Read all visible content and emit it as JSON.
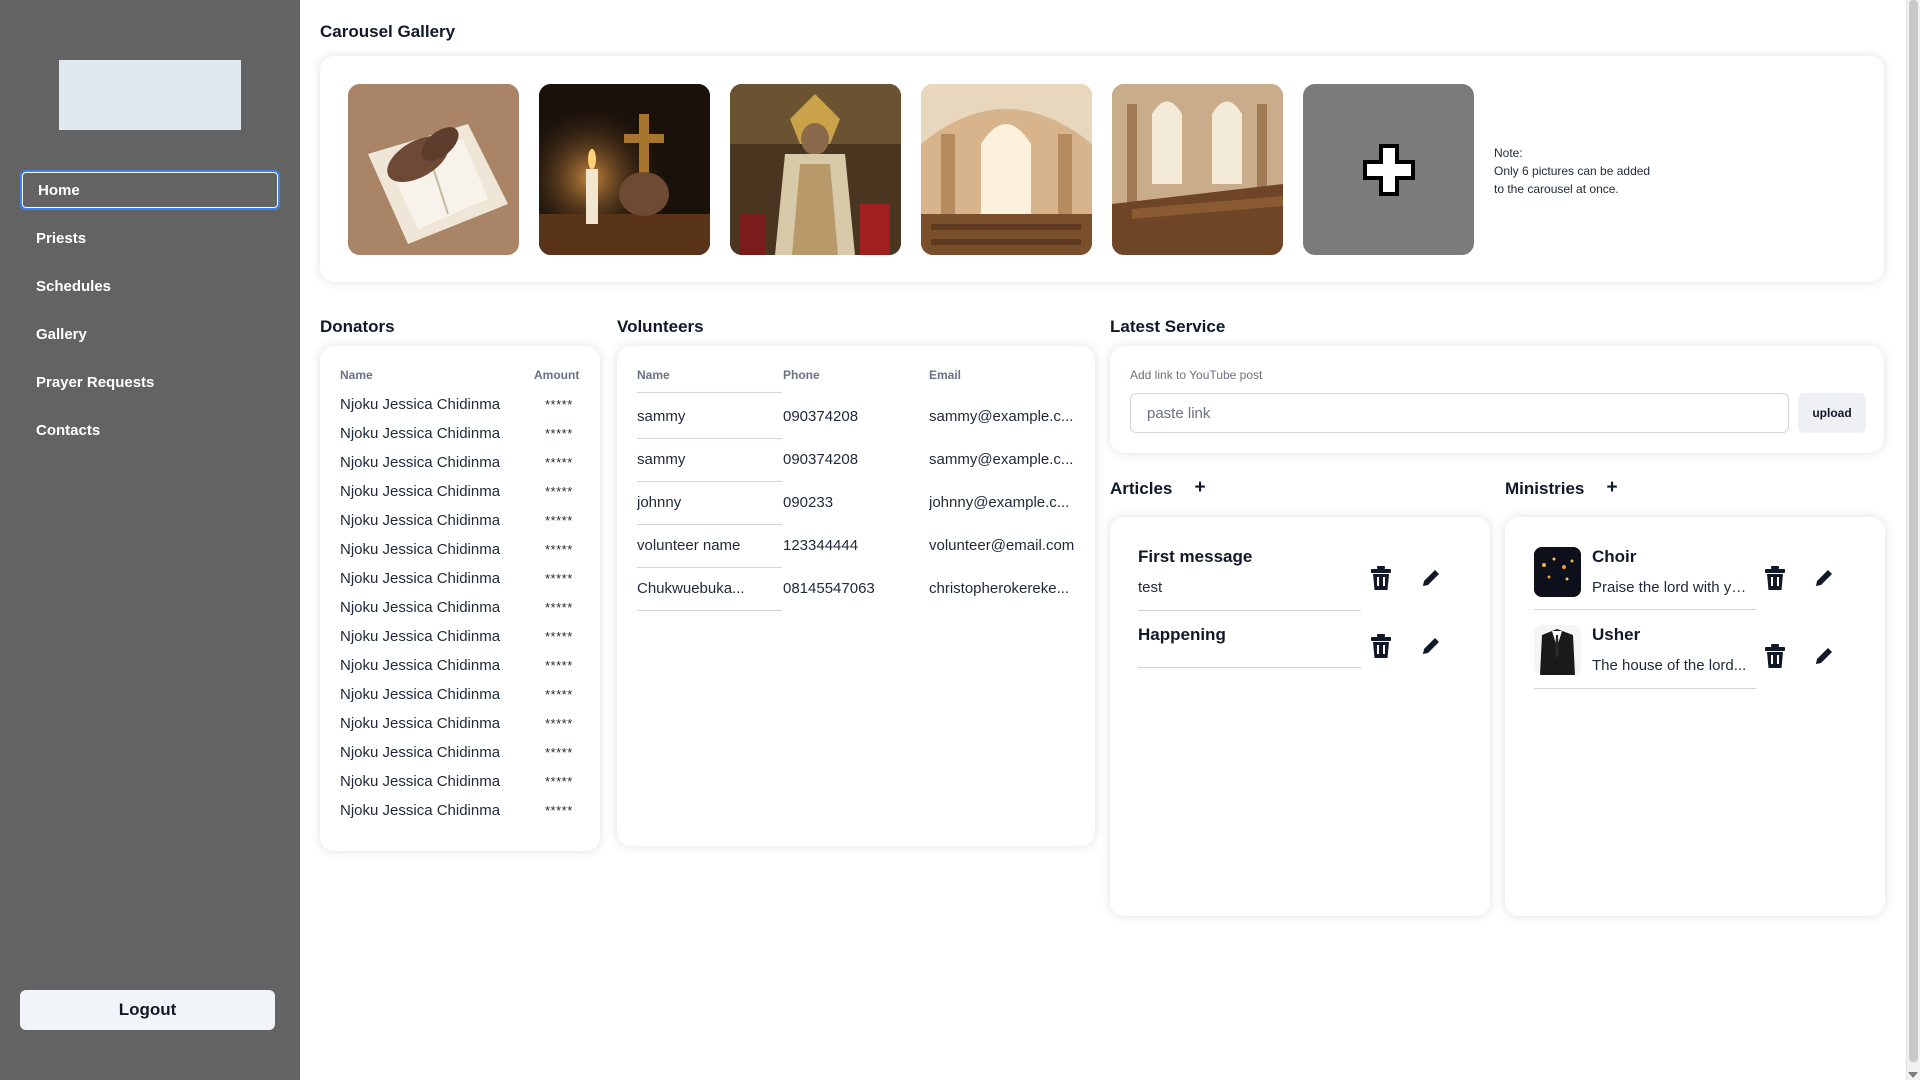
{
  "sidebar": {
    "items": [
      {
        "label": "Home"
      },
      {
        "label": "Priests"
      },
      {
        "label": "Schedules"
      },
      {
        "label": "Gallery"
      },
      {
        "label": "Prayer Requests"
      },
      {
        "label": "Contacts"
      }
    ],
    "active": "Home",
    "logout_label": "Logout"
  },
  "carousel": {
    "title": "Carousel Gallery",
    "images": [
      "hands-on-bible-image",
      "candle-and-cross-image",
      "saint-statue-image",
      "church-interior-image",
      "church-pews-image"
    ],
    "note_lines": [
      "Note:",
      "Only 6 pictures can be added",
      "to the carousel at once."
    ]
  },
  "donators": {
    "title": "Donators",
    "columns": [
      "Name",
      "Amount"
    ],
    "rows": [
      [
        "Njoku Jessica Chidinma",
        "*****"
      ],
      [
        "Njoku Jessica Chidinma",
        "*****"
      ],
      [
        "Njoku Jessica Chidinma",
        "*****"
      ],
      [
        "Njoku Jessica Chidinma",
        "*****"
      ],
      [
        "Njoku Jessica Chidinma",
        "*****"
      ],
      [
        "Njoku Jessica Chidinma",
        "*****"
      ],
      [
        "Njoku Jessica Chidinma",
        "*****"
      ],
      [
        "Njoku Jessica Chidinma",
        "*****"
      ],
      [
        "Njoku Jessica Chidinma",
        "*****"
      ],
      [
        "Njoku Jessica Chidinma",
        "*****"
      ],
      [
        "Njoku Jessica Chidinma",
        "*****"
      ],
      [
        "Njoku Jessica Chidinma",
        "*****"
      ],
      [
        "Njoku Jessica Chidinma",
        "*****"
      ],
      [
        "Njoku Jessica Chidinma",
        "*****"
      ],
      [
        "Njoku Jessica Chidinma",
        "*****"
      ]
    ]
  },
  "volunteers": {
    "title": "Volunteers",
    "columns": [
      "Name",
      "Phone",
      "Email"
    ],
    "rows": [
      [
        "sammy",
        "090374208",
        "sammy@example.c..."
      ],
      [
        "sammy",
        "090374208",
        "sammy@example.c..."
      ],
      [
        "johnny",
        "090233",
        "johnny@example.c..."
      ],
      [
        "volunteer name",
        "123344444",
        "volunteer@email.com"
      ],
      [
        "Chukwuebuka...",
        "08145547063",
        "christopherokereke..."
      ]
    ]
  },
  "latest_service": {
    "title": "Latest Service",
    "label": "Add link to YouTube post",
    "placeholder": "paste link",
    "value": "",
    "button_label": "upload"
  },
  "articles": {
    "title": "Articles",
    "add_symbol": "+",
    "items": [
      {
        "title": "First message",
        "subtitle": "test"
      },
      {
        "title": "Happening",
        "subtitle": ""
      }
    ]
  },
  "ministries": {
    "title": "Ministries",
    "add_symbol": "+",
    "items": [
      {
        "title": "Choir",
        "subtitle": "Praise the lord with yo...",
        "avatar": "choir-avatar"
      },
      {
        "title": "Usher",
        "subtitle": "The house of the lord...",
        "avatar": "usher-avatar"
      }
    ]
  },
  "colors": {
    "sidebar_bg": "#636363",
    "active_outline": "#3b82f6",
    "logo_placeholder": "#e2e8f0",
    "add_tile": "#7b7b7b"
  }
}
